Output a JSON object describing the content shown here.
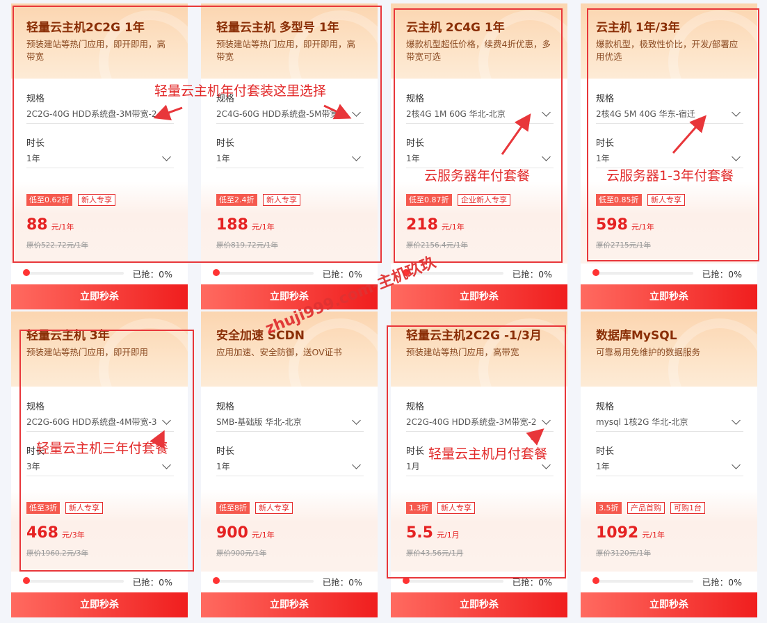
{
  "cards": [
    {
      "title": "轻量云主机2C2G 1年",
      "desc": "预装建站等热门应用，即开即用，高带宽",
      "spec_label": "规格",
      "spec": "2C2G-40G HDD系统盘-3M带宽-2",
      "dur_label": "时长",
      "dur": "1年",
      "tag1": "低至0.62折",
      "tag2": "新人专享",
      "tag3": "",
      "price": "88",
      "unit": "元/1年",
      "orig": "原价522.72元/1年",
      "sold_label": "已抢：0%",
      "sold_pct": 0,
      "button": "立即秒杀"
    },
    {
      "title": "轻量云主机 多型号 1年",
      "desc": "预装建站等热门应用，即开即用，高带宽",
      "spec_label": "规格",
      "spec": "2C4G-60G HDD系统盘-5M带宽-",
      "dur_label": "时长",
      "dur": "1年",
      "tag1": "低至2.4折",
      "tag2": "新人专享",
      "tag3": "",
      "price": "188",
      "unit": "元/1年",
      "orig": "原价819.72元/1年",
      "sold_label": "已抢：0%",
      "sold_pct": 0,
      "button": "立即秒杀"
    },
    {
      "title": "云主机 2C4G 1年",
      "desc": "爆款机型超低价格，续费4折优惠，多带宽可选",
      "spec_label": "规格",
      "spec": "2核4G 1M 60G 华北-北京",
      "dur_label": "时长",
      "dur": "1年",
      "tag1": "低至0.87折",
      "tag2": "企业新人专享",
      "tag3": "",
      "price": "218",
      "unit": "元/1年",
      "orig": "原价2156.4元/1年",
      "sold_label": "已抢：0%",
      "sold_pct": 0,
      "button": "立即秒杀"
    },
    {
      "title": "云主机 1年/3年",
      "desc": "爆款机型，极致性价比，开发/部署应用优选",
      "spec_label": "规格",
      "spec": "2核4G 5M 40G 华东-宿迁",
      "dur_label": "时长",
      "dur": "1年",
      "tag1": "低至0.85折",
      "tag2": "新人专享",
      "tag3": "",
      "price": "598",
      "unit": "元/1年",
      "orig": "原价2715元/1年",
      "sold_label": "已抢：0%",
      "sold_pct": 0,
      "button": "立即秒杀"
    },
    {
      "title": "轻量云主机 3年",
      "desc": "预装建站等热门应用，即开即用",
      "spec_label": "规格",
      "spec": "2C2G-60G HDD系统盘-4M带宽-3",
      "dur_label": "时长",
      "dur": "3年",
      "tag1": "低至3折",
      "tag2": "新人专享",
      "tag3": "",
      "price": "468",
      "unit": "元/3年",
      "orig": "原价1960.2元/3年",
      "sold_label": "已抢：0%",
      "sold_pct": 0,
      "button": "立即秒杀"
    },
    {
      "title": "安全加速 SCDN",
      "desc": "应用加速、安全防御，送OV证书",
      "spec_label": "规格",
      "spec": "SMB-基础版 华北-北京",
      "dur_label": "时长",
      "dur": "1年",
      "tag1": "低至8折",
      "tag2": "新人专享",
      "tag3": "",
      "price": "900",
      "unit": "元/1年",
      "orig": "原价900元/1年",
      "sold_label": "已抢：0%",
      "sold_pct": 0,
      "button": "立即秒杀"
    },
    {
      "title": "轻量云主机2C2G -1/3月",
      "desc": "预装建站等热门应用，高带宽",
      "spec_label": "规格",
      "spec": "2C2G-40G HDD系统盘-3M带宽-2",
      "dur_label": "时长",
      "dur": "1月",
      "tag1": "1.3折",
      "tag2": "新人专享",
      "tag3": "",
      "price": "5.5",
      "unit": "元/1月",
      "orig": "原价43.56元/1月",
      "sold_label": "已抢：0%",
      "sold_pct": 0,
      "button": "立即秒杀"
    },
    {
      "title": "数据库MySQL",
      "desc": "可靠易用免维护的数据服务",
      "spec_label": "规格",
      "spec": "mysql 1核2G 华北-北京",
      "dur_label": "时长",
      "dur": "1年",
      "tag1": "3.5折",
      "tag2": "产品首购",
      "tag3": "可购1台",
      "price": "1092",
      "unit": "元/1年",
      "orig": "原价3120元/1年",
      "sold_label": "已抢：0%",
      "sold_pct": 0,
      "button": "立即秒杀"
    }
  ],
  "annotations": {
    "a1": "轻量云主机年付套装这里选择",
    "a2": "云服务器年付套餐",
    "a3": "云服务器1-3年付套餐",
    "a4": "轻量云主机三年付套餐",
    "a5": "轻量云主机月付套餐",
    "watermark": "zhuji999.com-主机玖玖"
  },
  "colors": {
    "accent": "#e52222",
    "annotation": "#e8363a",
    "header": "#fbd5b0",
    "page_bg": "#f3f5fa"
  }
}
